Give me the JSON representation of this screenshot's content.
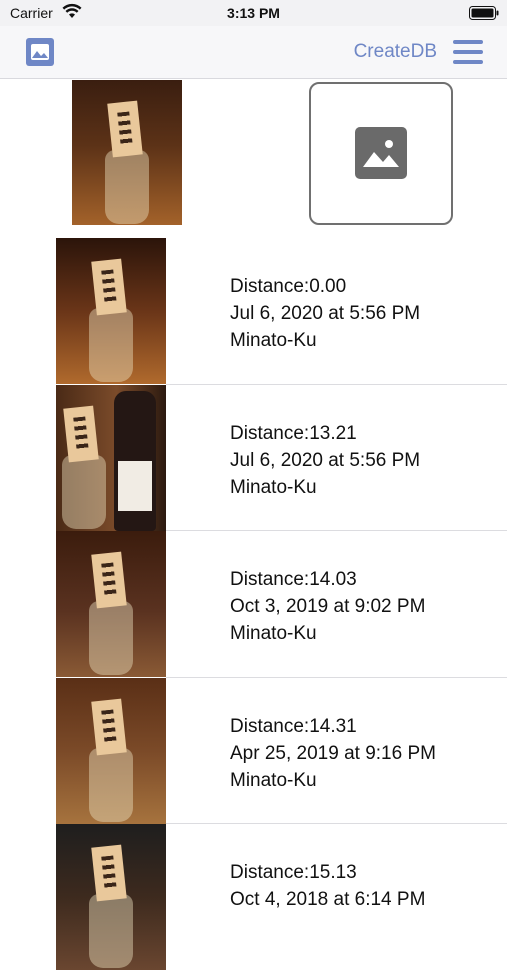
{
  "status_bar": {
    "carrier": "Carrier",
    "time": "3:13 PM"
  },
  "nav": {
    "left_icon": "photo-icon",
    "createdb_label": "CreateDB",
    "menu_icon": "hamburger-menu-icon"
  },
  "query": {
    "placeholder_icon": "image-placeholder-icon"
  },
  "results": [
    {
      "distance": "Distance:0.00",
      "date": "Jul 6, 2020 at 5:56 PM",
      "location": "Minato-Ku"
    },
    {
      "distance": "Distance:13.21",
      "date": "Jul 6, 2020 at 5:56 PM",
      "location": "Minato-Ku"
    },
    {
      "distance": "Distance:14.03",
      "date": "Oct 3, 2019 at 9:02 PM",
      "location": "Minato-Ku"
    },
    {
      "distance": "Distance:14.31",
      "date": "Apr 25, 2019 at 9:16 PM",
      "location": "Minato-Ku"
    },
    {
      "distance": "Distance:15.13",
      "date": "Oct 4, 2018 at 6:14 PM",
      "location": ""
    }
  ],
  "colors": {
    "accent": "#6f87c6",
    "navbar_bg": "#f7f7f9"
  }
}
